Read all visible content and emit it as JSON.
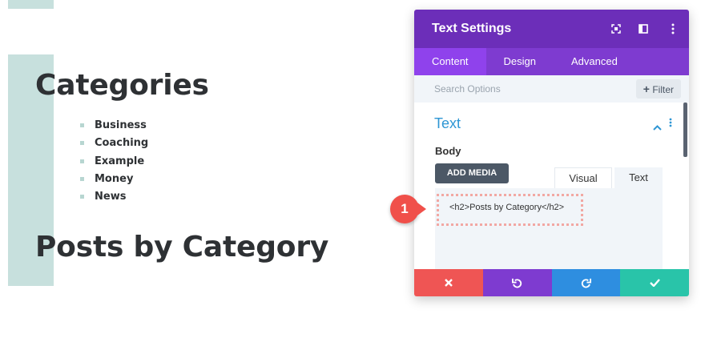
{
  "page": {
    "categories_heading": "Categories",
    "categories": [
      "Business",
      "Coaching",
      "Example",
      "Money",
      "News"
    ],
    "posts_heading": "Posts by Category"
  },
  "modal": {
    "title": "Text Settings",
    "header_icons": [
      "fullscreen-icon",
      "split-view-icon",
      "more-options-icon"
    ],
    "tabs": [
      {
        "label": "Content",
        "active": true
      },
      {
        "label": "Design",
        "active": false
      },
      {
        "label": "Advanced",
        "active": false
      }
    ],
    "search_placeholder": "Search Options",
    "filter_label": "Filter",
    "section_title": "Text",
    "body_label": "Body",
    "add_media_label": "ADD MEDIA",
    "editor_tabs": [
      {
        "label": "Visual",
        "active": false
      },
      {
        "label": "Text",
        "active": true
      }
    ],
    "editor_content": "<h2>Posts by Category</h2>",
    "marker_number": "1"
  },
  "colors": {
    "header": "#6c2eb9",
    "tabs": "#7e3bd0",
    "active_tab": "#8f42ec",
    "discard": "#ef5554",
    "undo": "#7e3bd0",
    "redo": "#2e8ee0",
    "save": "#29c4a9",
    "accent": "#c7e0dd"
  }
}
